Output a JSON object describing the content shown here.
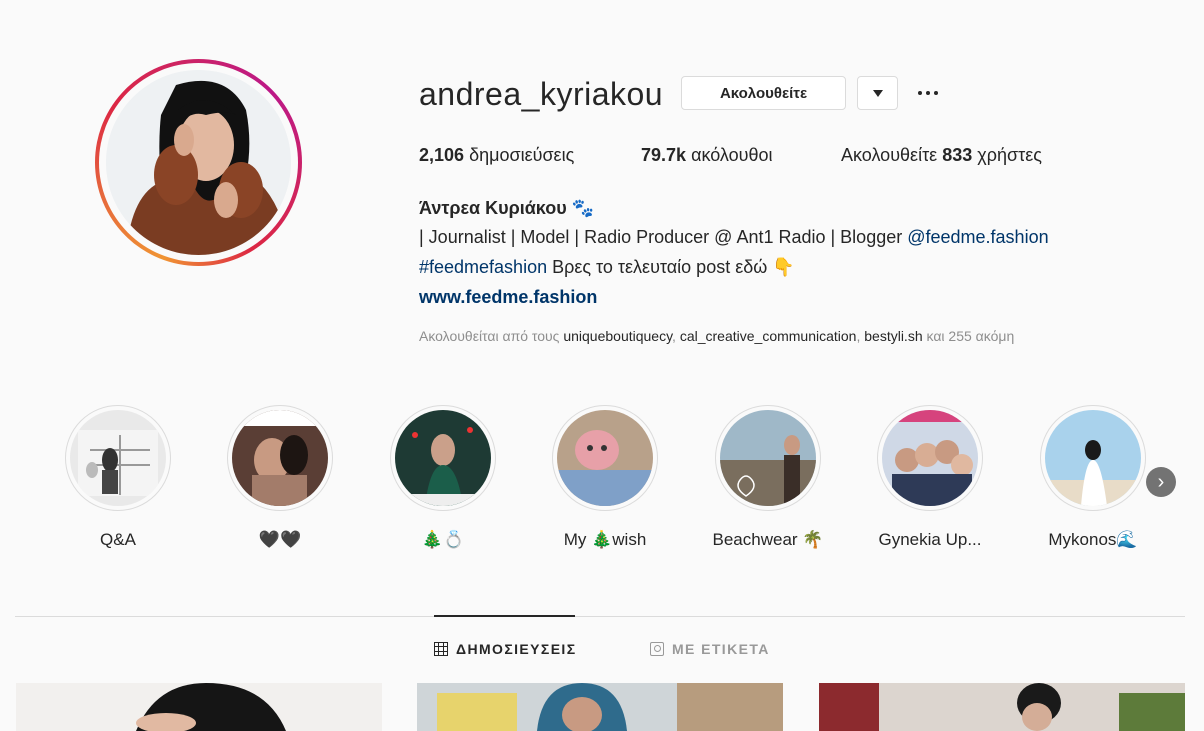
{
  "profile": {
    "username": "andrea_kyriakou",
    "follow_button": "Ακολουθείτε",
    "stats": {
      "posts_count": "2,106",
      "posts_label": "δημοσιεύσεις",
      "followers_count": "79.7k",
      "followers_label": "ακόλουθοι",
      "following_prefix": "Ακολουθείτε",
      "following_count": "833",
      "following_suffix": "χρήστες"
    },
    "bio": {
      "full_name": "Άντρεα Κυριάκου 🐾",
      "line1_text": "| Journalist | Model | Radio Producer @ Ant1 Radio | Blogger ",
      "line1_mention": "@feedme.fashion",
      "line2_hashtag": "#feedmefashion",
      "line2_text": " Βρες το τελευταίο post εδώ 👇",
      "website": "www.feedme.fashion"
    },
    "followed_by": {
      "prefix": "Ακολουθείται από τους ",
      "user1": "uniqueboutiquecy",
      "sep1": ", ",
      "user2": "cal_creative_communication",
      "sep2": ", ",
      "user3": "bestyli.sh",
      "suffix": " και 255 ακόμη"
    }
  },
  "highlights": [
    {
      "label": "Q&A"
    },
    {
      "label": "🖤🖤"
    },
    {
      "label": "🎄💍"
    },
    {
      "label": "My 🎄wish"
    },
    {
      "label": "Beachwear 🌴"
    },
    {
      "label": "Gynekia Up..."
    },
    {
      "label": "Mykonos🌊"
    }
  ],
  "tabs": {
    "posts": "ΔΗΜΟΣΙΕΥΣΕΙΣ",
    "tagged": "ΜΕ ΕΤΙΚΕΤΑ"
  },
  "colors": {
    "link": "#003569",
    "muted": "#8e8e8e",
    "border": "#dbdbdb",
    "background": "#fafafa"
  }
}
